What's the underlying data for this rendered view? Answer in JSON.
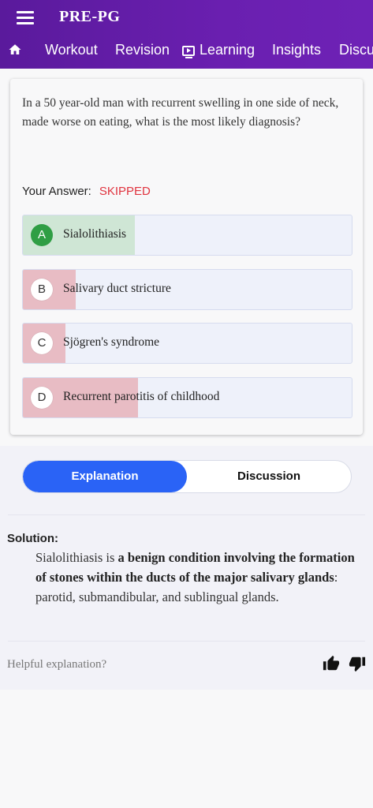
{
  "app": {
    "title": "PRE-PG"
  },
  "nav": {
    "items": [
      {
        "label": "Workout"
      },
      {
        "label": "Revision"
      },
      {
        "label": "Learning"
      },
      {
        "label": "Insights"
      },
      {
        "label": "Discu"
      }
    ]
  },
  "question": {
    "text": "In a 50 year-old man with recurrent swelling in one side of neck, made worse on eating, what is the most likely diagnosis?",
    "your_answer_label": "Your Answer:",
    "your_answer_status": "SKIPPED",
    "options": [
      {
        "letter": "A",
        "text": "Sialolithiasis",
        "correct": true,
        "response_share": 0.34
      },
      {
        "letter": "B",
        "text": "Salivary duct stricture",
        "correct": false,
        "response_share": 0.16
      },
      {
        "letter": "C",
        "text": "Sjögren's syndrome",
        "correct": false,
        "response_share": 0.13
      },
      {
        "letter": "D",
        "text": "Recurrent parotitis of childhood",
        "correct": false,
        "response_share": 0.35
      }
    ]
  },
  "colors": {
    "header": "#6a1fb0",
    "correct_fill": "#cfe6d5",
    "wrong_fill": "#e8bcc4",
    "correct_badge": "#2f9e44",
    "active_tab": "#2a63f6",
    "skipped": "#e0343f"
  },
  "tabs": {
    "explanation": "Explanation",
    "discussion": "Discussion"
  },
  "solution": {
    "label": "Solution:",
    "text_start": "Sialolithiasis is ",
    "text_bold": "a benign condition involving the formation of stones within the ducts of the major salivary glands",
    "text_end": ": parotid, submandibular, and sublingual glands."
  },
  "feedback": {
    "prompt": "Helpful explanation?",
    "icons": [
      "thumbs-up-icon",
      "thumbs-down-icon"
    ]
  }
}
